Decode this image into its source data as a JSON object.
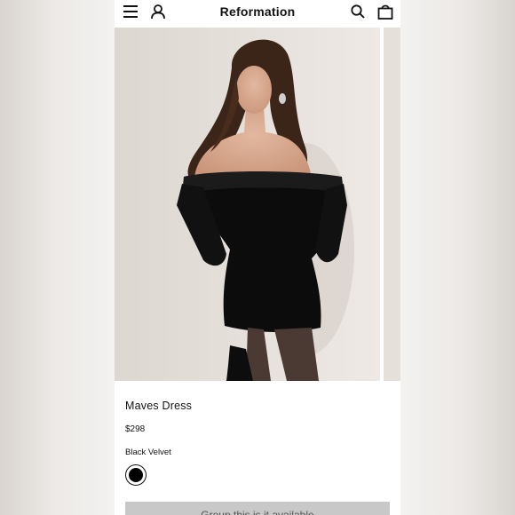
{
  "header": {
    "brand": "Reformation",
    "icons": [
      "menu-icon",
      "account-icon",
      "search-icon",
      "bag-icon"
    ]
  },
  "gallery": {
    "image_alt": "Model wearing black velvet off-the-shoulder mini dress"
  },
  "product": {
    "name": "Maves Dress",
    "price": "$298",
    "color_name": "Black Velvet",
    "swatch_color": "#000000"
  },
  "cta": {
    "label": "Group this is it available"
  }
}
